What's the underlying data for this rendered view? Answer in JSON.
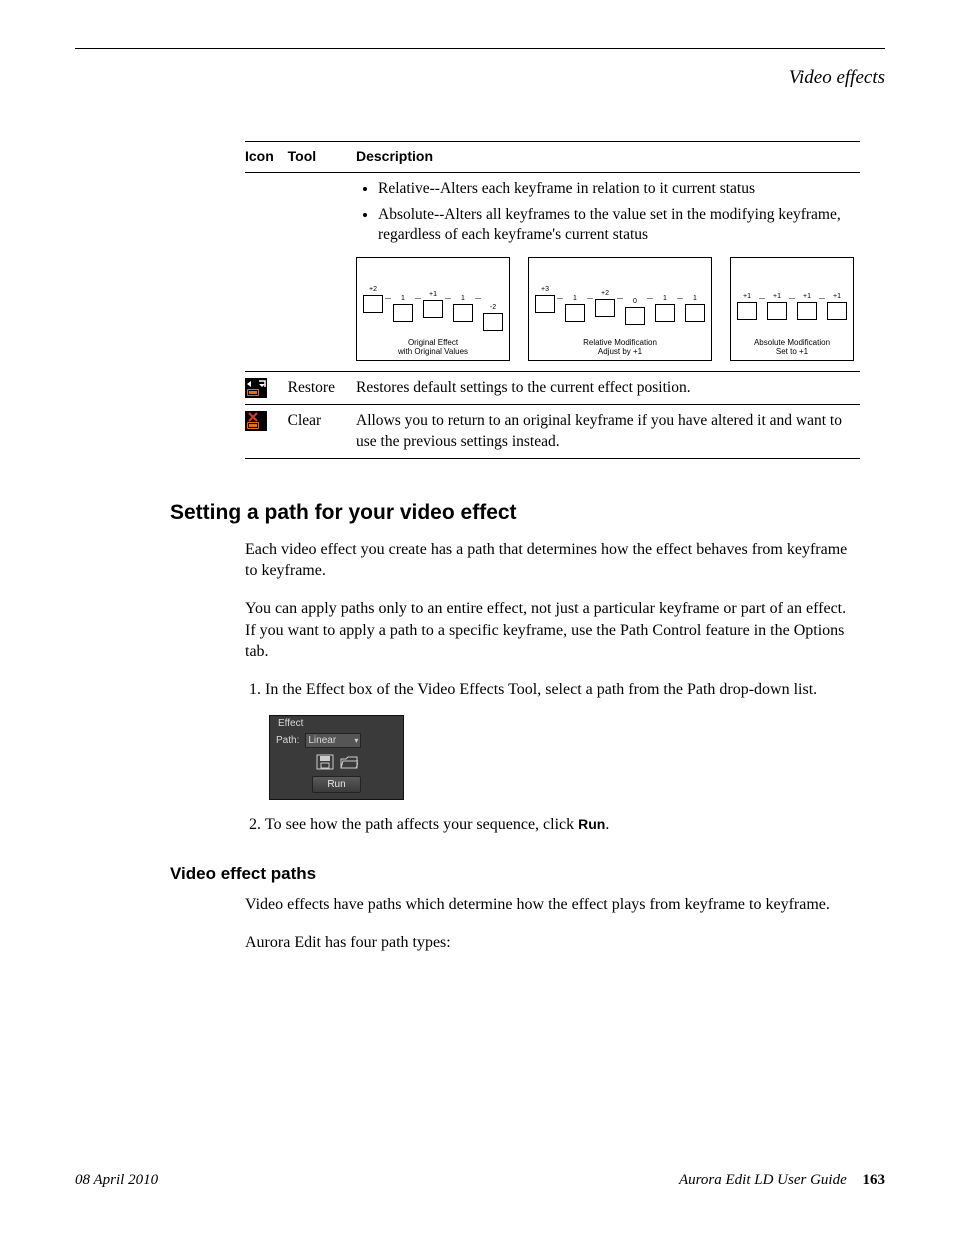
{
  "header": {
    "running_title": "Video effects"
  },
  "table": {
    "headers": {
      "icon": "Icon",
      "tool": "Tool",
      "description": "Description"
    },
    "row_continuation": {
      "bullets": [
        "Relative--Alters each keyframe in relation to it current status",
        "Absolute--Alters all keyframes to the value set in the modifying keyframe, regardless of each keyframe's current status"
      ],
      "diagrams": [
        {
          "labels": [
            "+2",
            "1",
            "+1",
            "1",
            "-2"
          ],
          "caption_line1": "Original Effect",
          "caption_line2": "with Original Values"
        },
        {
          "labels": [
            "+3",
            "1",
            "+2",
            "0",
            "1",
            "1"
          ],
          "caption_line1": "Relative Modification",
          "caption_line2": "Adjust by +1"
        },
        {
          "labels": [
            "+1",
            "+1",
            "+1",
            "+1"
          ],
          "caption_line1": "Absolute Modification",
          "caption_line2": "Set to +1"
        }
      ]
    },
    "row_restore": {
      "tool": "Restore",
      "description": "Restores default settings to the current effect position."
    },
    "row_clear": {
      "tool": "Clear",
      "description": "Allows you to return to an original keyframe if you have altered it and want to use the previous settings instead."
    }
  },
  "section": {
    "heading": "Setting a path for your video effect",
    "p1": "Each video effect you create has a path that determines how the effect behaves from keyframe to keyframe.",
    "p2": "You can apply paths only to an entire effect, not just a particular keyframe or part of an effect. If you want to apply a path to a specific keyframe, use the Path Control feature in the Options tab.",
    "steps": {
      "s1": "In the Effect box of the Video Effects Tool, select a path from the Path drop-down list.",
      "s2_prefix": "To see how the path affects your sequence, click ",
      "s2_bold": "Run",
      "s2_suffix": "."
    },
    "effect_panel": {
      "legend": "Effect",
      "path_label": "Path:",
      "path_value": "Linear",
      "run_label": "Run"
    }
  },
  "subsection": {
    "heading": "Video effect paths",
    "p1": "Video effects have paths which determine how the effect plays from keyframe to keyframe.",
    "p2": "Aurora Edit has four path types:"
  },
  "footer": {
    "date": "08 April 2010",
    "guide": "Aurora Edit LD User Guide",
    "page": "163"
  }
}
